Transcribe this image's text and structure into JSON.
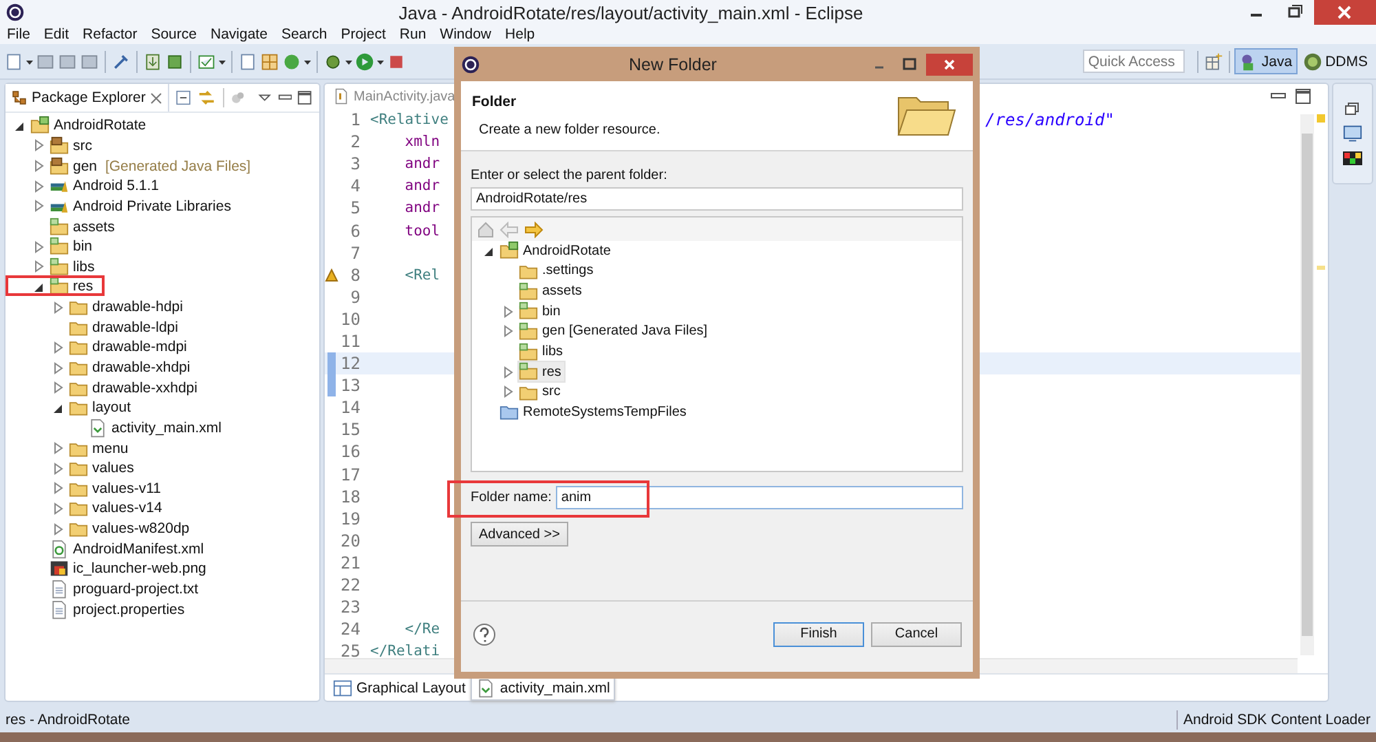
{
  "window": {
    "title": "Java - AndroidRotate/res/layout/activity_main.xml - Eclipse"
  },
  "menu": [
    "File",
    "Edit",
    "Refactor",
    "Source",
    "Navigate",
    "Search",
    "Project",
    "Run",
    "Window",
    "Help"
  ],
  "toolbar": {
    "quick_access": {
      "placeholder": "Quick Access"
    },
    "perspectives": [
      {
        "label": "Java",
        "selected": true
      },
      {
        "label": "DDMS",
        "selected": false
      }
    ]
  },
  "package_explorer": {
    "title": "Package Explorer",
    "tree": [
      {
        "label": "AndroidRotate",
        "kind": "project",
        "expandable": true,
        "expanded": true,
        "highlighted": false,
        "children": [
          {
            "label": "src",
            "kind": "source",
            "expandable": true,
            "expanded": false,
            "highlighted": false
          },
          {
            "label": "gen",
            "note": "[Generated Java Files]",
            "kind": "source",
            "expandable": true,
            "expanded": false,
            "highlighted": false
          },
          {
            "label": "Android 5.1.1",
            "kind": "library",
            "expandable": true,
            "expanded": false,
            "highlighted": false
          },
          {
            "label": "Android Private Libraries",
            "kind": "library",
            "expandable": true,
            "expanded": false,
            "highlighted": false
          },
          {
            "label": "assets",
            "kind": "res",
            "highlighted": false
          },
          {
            "label": "bin",
            "kind": "res",
            "expandable": true,
            "expanded": false,
            "highlighted": false
          },
          {
            "label": "libs",
            "kind": "res",
            "expandable": true,
            "expanded": false,
            "highlighted": false
          },
          {
            "label": "res",
            "kind": "res",
            "expandable": true,
            "expanded": true,
            "highlighted": true,
            "children": [
              {
                "label": "drawable-hdpi",
                "kind": "folder",
                "expandable": true,
                "expanded": false,
                "highlighted": false
              },
              {
                "label": "drawable-ldpi",
                "kind": "folder",
                "highlighted": false
              },
              {
                "label": "drawable-mdpi",
                "kind": "folder",
                "expandable": true,
                "expanded": false,
                "highlighted": false
              },
              {
                "label": "drawable-xhdpi",
                "kind": "folder",
                "expandable": true,
                "expanded": false,
                "highlighted": false
              },
              {
                "label": "drawable-xxhdpi",
                "kind": "folder",
                "expandable": true,
                "expanded": false,
                "highlighted": false
              },
              {
                "label": "layout",
                "kind": "folder",
                "expandable": true,
                "expanded": true,
                "highlighted": false,
                "children": [
                  {
                    "label": "activity_main.xml",
                    "kind": "xml",
                    "highlighted": false
                  }
                ]
              },
              {
                "label": "menu",
                "kind": "folder",
                "expandable": true,
                "expanded": false,
                "highlighted": false
              },
              {
                "label": "values",
                "kind": "folder",
                "expandable": true,
                "expanded": false,
                "highlighted": false
              },
              {
                "label": "values-v11",
                "kind": "folder",
                "expandable": true,
                "expanded": false,
                "highlighted": false
              },
              {
                "label": "values-v14",
                "kind": "folder",
                "expandable": true,
                "expanded": false,
                "highlighted": false
              },
              {
                "label": "values-w820dp",
                "kind": "folder",
                "expandable": true,
                "expanded": false,
                "highlighted": false
              }
            ]
          },
          {
            "label": "AndroidManifest.xml",
            "kind": "manifest",
            "highlighted": false
          },
          {
            "label": "ic_launcher-web.png",
            "kind": "image",
            "highlighted": false
          },
          {
            "label": "proguard-project.txt",
            "kind": "text",
            "highlighted": false
          },
          {
            "label": "project.properties",
            "kind": "text",
            "highlighted": false
          }
        ]
      }
    ]
  },
  "editor": {
    "tabs": [
      {
        "label": "MainActivity.java",
        "selected": false
      }
    ],
    "lines": [
      {
        "number": "1",
        "code": "<Relative",
        "kind": "tag",
        "tail": "/res/android\"",
        "warning": false,
        "current": false
      },
      {
        "number": "2",
        "code": "    xmln",
        "kind": "attr",
        "warning": false,
        "current": false
      },
      {
        "number": "3",
        "code": "    andr",
        "kind": "attr",
        "warning": false,
        "current": false
      },
      {
        "number": "4",
        "code": "    andr",
        "kind": "attr",
        "warning": false,
        "current": false
      },
      {
        "number": "5",
        "code": "    andr",
        "kind": "attr",
        "warning": false,
        "current": false
      },
      {
        "number": "6",
        "code": "    tool",
        "kind": "attr",
        "warning": false,
        "current": false
      },
      {
        "number": "7",
        "warning": false,
        "current": false
      },
      {
        "number": "8",
        "code": "    <Rel",
        "kind": "tag",
        "warning": true,
        "current": false
      },
      {
        "number": "9",
        "warning": false,
        "current": false
      },
      {
        "number": "10",
        "warning": false,
        "current": false
      },
      {
        "number": "11",
        "warning": false,
        "current": false
      },
      {
        "number": "12",
        "warning": false,
        "current": true
      },
      {
        "number": "13",
        "warning": false,
        "current": false
      },
      {
        "number": "14",
        "warning": false,
        "current": false
      },
      {
        "number": "15",
        "warning": false,
        "current": false
      },
      {
        "number": "16",
        "warning": false,
        "current": false
      },
      {
        "number": "17",
        "warning": false,
        "current": false
      },
      {
        "number": "18",
        "warning": false,
        "current": false
      },
      {
        "number": "19",
        "warning": false,
        "current": false
      },
      {
        "number": "20",
        "warning": false,
        "current": false
      },
      {
        "number": "21",
        "warning": false,
        "current": false
      },
      {
        "number": "22",
        "warning": false,
        "current": false
      },
      {
        "number": "23",
        "warning": false,
        "current": false
      },
      {
        "number": "24",
        "code": "    </Re",
        "kind": "tag",
        "warning": false,
        "current": false
      },
      {
        "number": "25",
        "code": "</Relati",
        "kind": "tag",
        "warning": false,
        "current": false
      }
    ],
    "bottom_tabs": [
      {
        "label": "Graphical Layout",
        "kind": "layout",
        "selected": false
      },
      {
        "label": "activity_main.xml",
        "kind": "xml",
        "selected": true
      }
    ]
  },
  "dialog": {
    "title": "New Folder",
    "heading": "Folder",
    "description": "Create a new folder resource.",
    "parent_label": "Enter or select the parent folder:",
    "parent_value": "AndroidRotate/res",
    "tree": [
      {
        "label": "AndroidRotate",
        "kind": "project",
        "expandable": true,
        "expanded": true,
        "selected": false,
        "children": [
          {
            "label": ".settings",
            "kind": "folder",
            "selected": false
          },
          {
            "label": "assets",
            "kind": "res",
            "selected": false
          },
          {
            "label": "bin",
            "kind": "res",
            "expandable": true,
            "expanded": false,
            "selected": false
          },
          {
            "label": "gen [Generated Java Files]",
            "kind": "res",
            "expandable": true,
            "expanded": false,
            "selected": false
          },
          {
            "label": "libs",
            "kind": "res",
            "selected": false
          },
          {
            "label": "res",
            "kind": "res",
            "expandable": true,
            "expanded": false,
            "selected": true
          },
          {
            "label": "src",
            "kind": "folder",
            "expandable": true,
            "expanded": false,
            "selected": false
          }
        ]
      },
      {
        "label": "RemoteSystemsTempFiles",
        "kind": "remote",
        "selected": false
      }
    ],
    "folder_name": {
      "label": "Folder name:",
      "value": "anim",
      "highlighted": true
    },
    "advanced_button": "Advanced >>",
    "buttons": [
      {
        "label": "Finish",
        "default": true
      },
      {
        "label": "Cancel",
        "default": false
      }
    ]
  },
  "status_bar": {
    "left": "res - AndroidRotate",
    "right": "Android SDK Content Loader"
  }
}
